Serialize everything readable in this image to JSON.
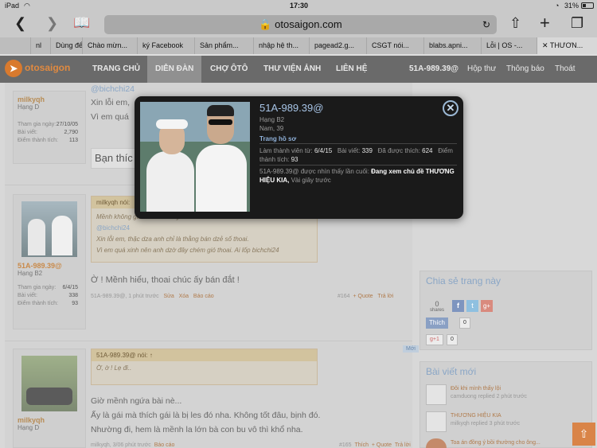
{
  "status": {
    "device": "iPad",
    "wifi": "wifi-icon",
    "time": "17:30",
    "battery": "31%"
  },
  "toolbar": {
    "url": "otosaigon.com"
  },
  "tabs": [
    "nl",
    "Dùng để",
    "Chào mừn...",
    "ký Facebook",
    "Sản phẩm...",
    "nhập hệ th...",
    "pagead2.g...",
    "CSGT nói...",
    "blabs.apni...",
    "Lỗi | OS -...",
    "THƯƠN..."
  ],
  "nav": {
    "logo": "otosaigon",
    "items": [
      "TRANG CHỦ",
      "DIỄN ĐÀN",
      "CHỢ ÔTÔ",
      "THƯ VIỆN ẢNH",
      "LIÊN HỆ"
    ],
    "user": "51A-989.39@",
    "links": [
      "Hộp thư",
      "Thông báo",
      "Thoát"
    ]
  },
  "post1": {
    "user": "milkyqh",
    "rank": "Hạng D",
    "stats": [
      {
        "k": "Tham gia ngày:",
        "v": "27/10/05"
      },
      {
        "k": "Bài viết:",
        "v": "2,790"
      },
      {
        "k": "Điểm thành tích:",
        "v": "113"
      }
    ],
    "mention": "@bichchi24",
    "line1": "Xin lỗi em,",
    "line2": "Vì em quá",
    "reply_placeholder": "Bạn thíc"
  },
  "post2": {
    "user": "51A-989.39@",
    "rank": "Hạng B2",
    "stats": [
      {
        "k": "Tham gia ngày:",
        "v": "6/4/15"
      },
      {
        "k": "Bài viết:",
        "v": "338"
      },
      {
        "k": "Điểm thành tích:",
        "v": "93"
      }
    ],
    "quote_head": "milkyqh nói:",
    "quote_lines": [
      "Mềnh không gái đủ để bắc ấy đi. Mềnh là thần mên thành ất dza",
      "@bichchi24",
      "Xin lỗi em, thặc dza anh chỉ là thằng bán dzẻ số thoai.",
      "Vì em quá xinh nên anh dzờ đây chém gió thoai. Ai lốp bichchi24"
    ],
    "message": "Ờ ! Mềnh hiểu, thoai chúc ấy bán đắt !",
    "footer": {
      "user": "51A-989.39@,",
      "time": "1 phút trước",
      "edit": "Sửa",
      "del": "Xóa",
      "report": "Báo cáo",
      "num": "#164",
      "quote": "+ Quote",
      "reply": "Trả lời"
    }
  },
  "post3": {
    "user": "milkyqh",
    "rank": "Hạng D",
    "badge": "Mới",
    "quote_head": "51A-989.39@ nói: ↑",
    "quote_line": "Ờ, ờ ! Lẹ đi..",
    "lines": [
      "Giờ mềnh ngứa bài nè...",
      "Ấy là gái mà thích gái là bị les đó nha. Không tốt đâu, bịnh đó.",
      "Nhường đi, hem là mềnh la lớn bà con bu vô thì khổ nha."
    ],
    "footer": {
      "time": "milkyqh, 3/06 phút trước",
      "report": "Báo cáo",
      "num": "#165",
      "like": "Thích",
      "quote": "+ Quote",
      "reply": "Trả lời"
    }
  },
  "share": {
    "title": "Chia sẻ trang này",
    "shares_count": "0",
    "shares_label": "shares",
    "like": "Thích",
    "like_count": "0",
    "gplus": "g+1",
    "gplus_count": "0"
  },
  "recent": {
    "title": "Bài viết mới",
    "items": [
      {
        "title": "Đôi khi mình thấy lội",
        "meta": "camduong replied 2 phút trước"
      },
      {
        "title": "THƯƠNG HIỆU KIA",
        "meta": "milkyqh replied 3 phút trước"
      },
      {
        "title": "Toa án đồng ý bồi thường cho ông...",
        "meta": ""
      }
    ]
  },
  "popup": {
    "name": "51A-989.39@",
    "rank": "Hạng B2",
    "info": "Nam, 39",
    "profile_link": "Trang hồ sơ",
    "joined_label": "Làm thành viên từ:",
    "joined": "6/4/15",
    "posts_label": "Bài viết:",
    "posts": "339",
    "likes_label": "Đã được thích:",
    "likes": "624",
    "points_label": "Điểm thành tích:",
    "points": "93",
    "seen_prefix": "51A-989.39@ được nhìn thấy lần cuối:",
    "seen_activity": "Đang xem chủ đề THƯƠNG HIỆU KIA,",
    "seen_time": "Vài giây trước"
  }
}
